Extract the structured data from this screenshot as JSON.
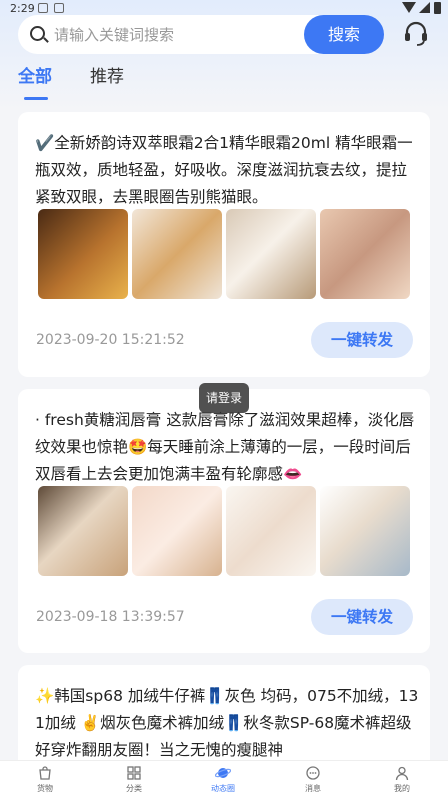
{
  "status_bar": {
    "time": "2:29"
  },
  "search": {
    "placeholder": "请输入关键词搜索",
    "button_label": "搜索"
  },
  "tabs": [
    {
      "label": "全部",
      "active": true
    },
    {
      "label": "推荐",
      "active": false
    }
  ],
  "posts": [
    {
      "text": "✔️全新娇韵诗双萃眼霜2合1精华眼霜20ml 精华眼霜一瓶双效，质地轻盈，好吸收。深度滋润抗衰去纹，提拉紧致双眼，去黑眼圈告别熊猫眼。",
      "images": [
        "product-photo",
        "product-photo",
        "product-photo",
        "product-photo"
      ],
      "time": "2023-09-20 15:21:52",
      "share_label": "一键转发"
    },
    {
      "text": "· fresh黄糖润唇膏 这款唇膏除了滋润效果超棒，淡化唇纹效果也惊艳🤩每天睡前涂上薄薄的一层，一段时间后双唇看上去会更加饱满丰盈有轮廓感👄",
      "images": [
        "product-photo",
        "product-photo",
        "product-photo",
        "product-photo"
      ],
      "time": "2023-09-18 13:39:57",
      "share_label": "一键转发"
    },
    {
      "text": "✨韩国sp68 加绒牛仔裤👖灰色 均码，075不加绒，131加绒 ✌️烟灰色魔术裤加绒👖秋冬款SP-68魔术裤超级好穿炸翻朋友圈！当之无愧的瘦腿神"
    }
  ],
  "toast": "请登录",
  "bottom_nav": [
    {
      "label": "货物",
      "icon": "bag-icon"
    },
    {
      "label": "分类",
      "icon": "grid-icon"
    },
    {
      "label": "动态圈",
      "icon": "planet-icon",
      "active": true
    },
    {
      "label": "消息",
      "icon": "chat-icon"
    },
    {
      "label": "我的",
      "icon": "user-icon"
    }
  ],
  "colors": {
    "accent": "#3d78f4",
    "share_bg": "#dde8fb"
  }
}
